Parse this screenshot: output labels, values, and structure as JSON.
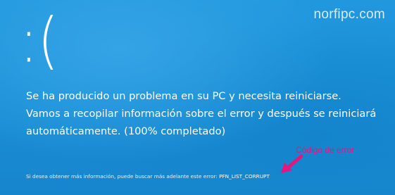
{
  "watermark": "norfipc.com",
  "sad_face": ":(",
  "message": {
    "line1": "Se ha producido un problema en su PC y necesita reiniciarse.",
    "line2": "Vamos a recopilar información sobre el error y después se reiniciará",
    "line3": "automáticamente. (100% completado)"
  },
  "error_info": {
    "prefix": "Si desea obtener más información, puede buscar más adelante este error: ",
    "code": "PFN_LIST_CORRUPT"
  },
  "annotation": {
    "label": "Código de error",
    "color": "#e8147f",
    "icon": "arrow-icon"
  },
  "colors": {
    "background": "#1a8fd6",
    "text": "#ffffff"
  }
}
